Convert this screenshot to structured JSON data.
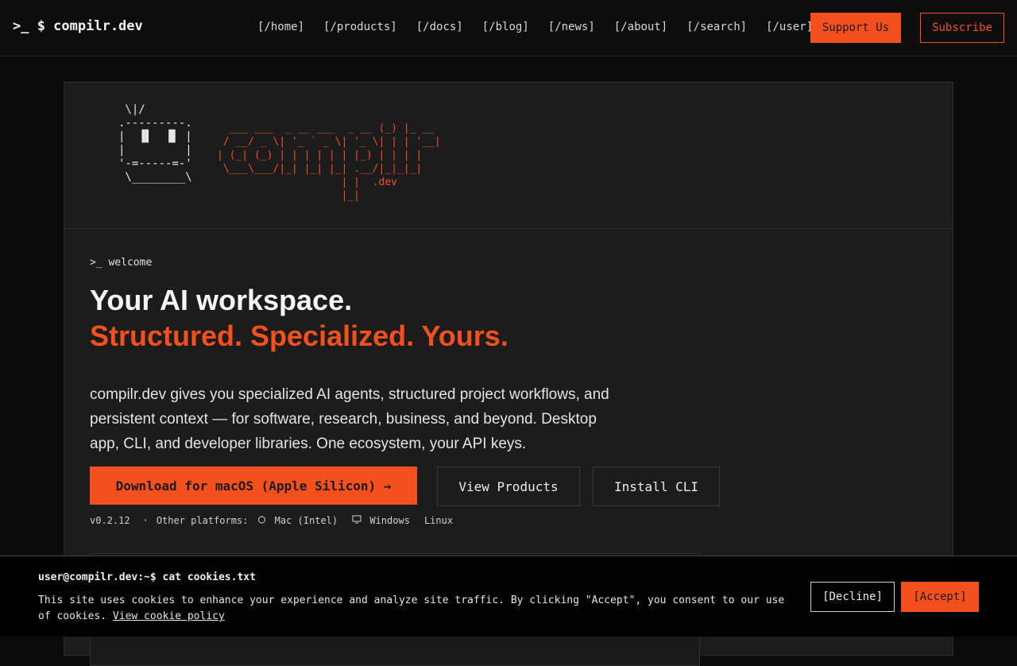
{
  "header": {
    "brand": ">_ $ compilr.dev",
    "nav": [
      "[/home]",
      "[/products]",
      "[/docs]",
      "[/blog]",
      "[/news]",
      "[/about]",
      "[/search]",
      "[/user]"
    ],
    "support_label": "Support Us",
    "subscribe_label": "Subscribe"
  },
  "hero": {
    "robot_ascii": " \\|/\n.---------.\n|  ▐▌  ▐▌ |\n|         |\n'-=-----=-'\n \\________\\",
    "logo_ascii": "  ___ ___  _ __ ___  _ __ (_) |_ __\n / __/ _ \\| '_ ` _ \\| '_ \\| | | '__|\n| (_| (_) | | | | | | |_) | | | |\n \\___\\___/|_| |_| |_| .__/|_|_|_|\n                    | |  .dev\n                    |_|",
    "prompt": ">_ welcome",
    "headline": "Your AI workspace.",
    "tagline": "Structured. Specialized. Yours.",
    "description": "compilr.dev gives you specialized AI agents, structured project workflows, and persistent context — for software, research, business, and beyond. Desktop app, CLI, and developer libraries. One ecosystem, your API keys.",
    "download_label": "Download for macOS (Apple Silicon) →",
    "view_products_label": "View Products",
    "install_cli_label": "Install CLI",
    "version": "v0.2.12",
    "separator": "·",
    "other_platforms_label": "Other platforms:",
    "platforms": [
      "Mac (Intel)",
      "Windows",
      "Linux"
    ]
  },
  "cookie": {
    "command": "user@compilr.dev:~$ cat cookies.txt",
    "text": "This site uses cookies to enhance your experience and analyze site traffic. By clicking \"Accept\", you consent to our use of cookies.",
    "policy_link": "View cookie policy",
    "decline_label": "[Decline]",
    "accept_label": "[Accept]"
  },
  "colors": {
    "accent": "#f4501e",
    "background": "#0b0b0b",
    "card": "#1c1c1c"
  }
}
